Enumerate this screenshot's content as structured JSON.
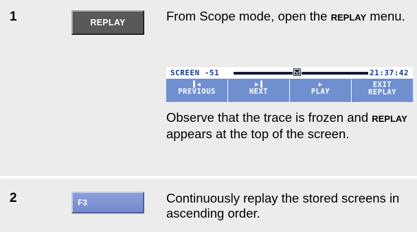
{
  "steps": [
    {
      "number": "1",
      "key_label": "REPLAY",
      "text_before": "From Scope mode, open the ",
      "text_keyword": "REPLAY",
      "text_after": " menu.",
      "observe_before": "Observe that the trace is frozen and ",
      "observe_keyword": "REPLAY",
      "observe_after": " appears at the top of the screen."
    },
    {
      "number": "2",
      "key_label": "F3",
      "text": "Continuously replay the stored screens in ascending order."
    }
  ],
  "screen": {
    "label": "SCREEN -51",
    "time": "21:37:42",
    "progress_position": 0.47,
    "softkeys": [
      {
        "icon": "previous-icon",
        "line1": "PREVIOUS",
        "line2": ""
      },
      {
        "icon": "next-icon",
        "line1": "NEXT",
        "line2": ""
      },
      {
        "icon": "play-icon",
        "line1": "PLAY",
        "line2": ""
      },
      {
        "icon": "",
        "line1": "EXIT",
        "line2": "REPLAY"
      }
    ]
  },
  "colors": {
    "row_background": "#ececec",
    "replay_key": "#595959",
    "f3_key": "#7f95d4",
    "screen_blue": "#6f8fcf"
  }
}
